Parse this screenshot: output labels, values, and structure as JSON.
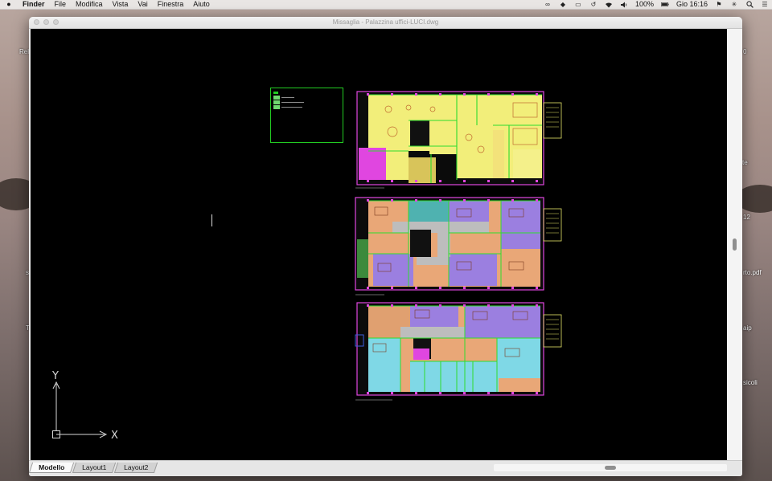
{
  "menubar": {
    "apple_icon": "apple-icon",
    "app_name": "Finder",
    "items": [
      "File",
      "Modifica",
      "Vista",
      "Vai",
      "Finestra",
      "Aiuto"
    ],
    "status": {
      "battery_percent": "100%",
      "clock": "Gio 16:16"
    }
  },
  "desktop": {
    "labels": [
      "Rel",
      "te",
      "12",
      "rto.pdf",
      "s",
      "T",
      "aip",
      "sicoli",
      "0"
    ]
  },
  "window": {
    "title": "Missaglia - Palazzina uffici-LUCI.dwg",
    "tabs": [
      "Modello",
      "Layout1",
      "Layout2"
    ],
    "active_tab": "Modello"
  },
  "drawing": {
    "ucs_x_label": "X",
    "ucs_y_label": "Y",
    "colors": {
      "canvas": "#000000",
      "plan_yellow": "#f2ee7a",
      "plan_orange": "#e9a777",
      "plan_purple": "#9b7fe0",
      "plan_cyan": "#7fd8e6",
      "plan_teal": "#4fb2b0",
      "plan_magenta": "#e046e0",
      "wall_green": "#2fdc2f",
      "legend_green": "#22cc22"
    }
  }
}
